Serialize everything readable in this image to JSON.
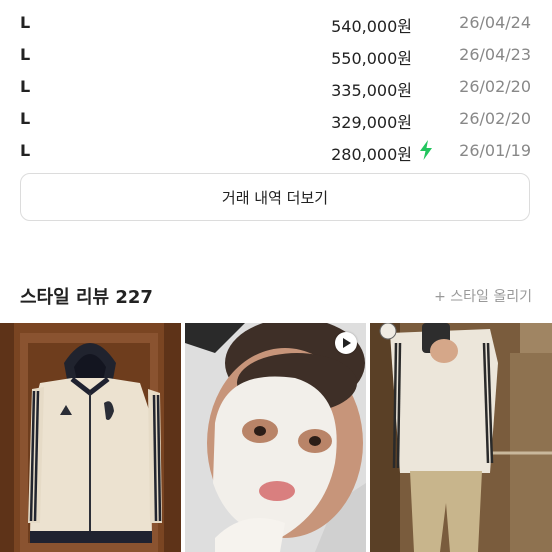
{
  "trades": [
    {
      "size": "L",
      "price": "540,000원",
      "date": "26/04/24",
      "fast": false
    },
    {
      "size": "L",
      "price": "550,000원",
      "date": "26/04/23",
      "fast": false
    },
    {
      "size": "L",
      "price": "335,000원",
      "date": "26/02/20",
      "fast": false
    },
    {
      "size": "L",
      "price": "329,000원",
      "date": "26/02/20",
      "fast": false
    },
    {
      "size": "L",
      "price": "280,000원",
      "date": "26/01/19",
      "fast": true
    }
  ],
  "more_button_label": "거래 내역 더보기",
  "style_review": {
    "title": "스타일 리뷰 227",
    "upload_label": "+ 스타일 올리기"
  },
  "photos": [
    {
      "icon": "track-jacket-photo"
    },
    {
      "icon": "face-mask-video",
      "video": true
    },
    {
      "icon": "mirror-selfie-photo"
    }
  ],
  "colors": {
    "bolt": "#22c55e",
    "date": "#888888",
    "border": "#dcdcdc"
  }
}
